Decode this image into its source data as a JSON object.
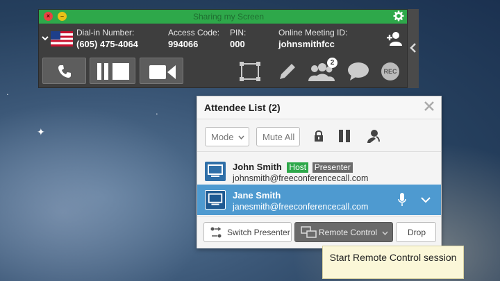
{
  "toolbar": {
    "title": "Sharing my Screen",
    "dialin_label": "Dial-in Number:",
    "dialin_value": "(605) 475-4064",
    "access_label": "Access Code:",
    "access_value": "994066",
    "pin_label": "PIN:",
    "pin_value": "000",
    "meeting_label": "Online Meeting ID:",
    "meeting_value": "johnsmithfcc",
    "participants_badge": "2",
    "rec_label": "REC"
  },
  "panel": {
    "title": "Attendee List (2)",
    "mode_label": "Mode",
    "mute_all_label": "Mute All",
    "attendees": [
      {
        "name": "John Smith",
        "email": "johnsmith@freeconferencecall.com",
        "tags": [
          "Host",
          "Presenter"
        ]
      },
      {
        "name": "Jane Smith",
        "email": "janesmith@freeconferencecall.com",
        "tags": []
      }
    ],
    "switch_presenter_label": "Switch Presenter",
    "remote_control_label": "Remote Control",
    "drop_label": "Drop"
  },
  "tooltip": {
    "text": "Start Remote Control session"
  },
  "colors": {
    "titlebar": "#2ea84a",
    "selected_row": "#4e9ad0",
    "host_tag": "#2ea84a",
    "presenter_tag": "#6b6b6b"
  }
}
